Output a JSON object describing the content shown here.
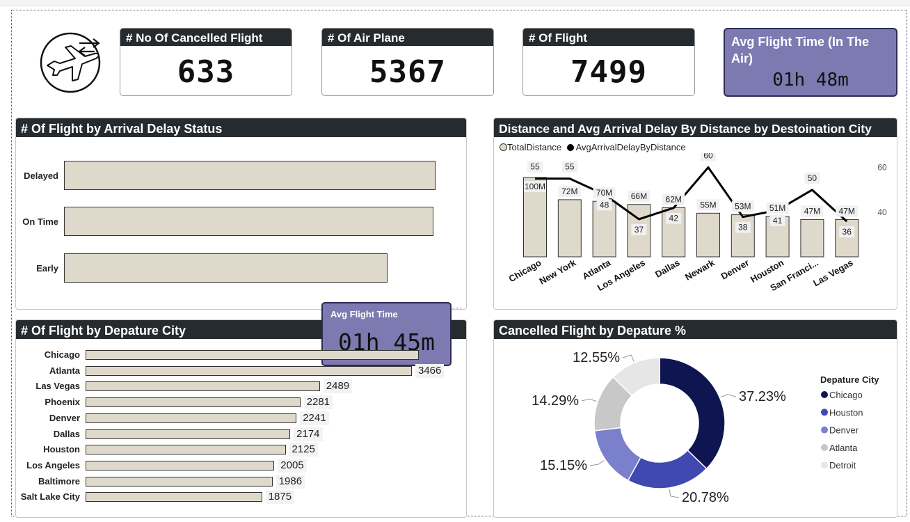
{
  "kpis": {
    "cancelled": {
      "label": "# No Of Cancelled Flight",
      "value": "633"
    },
    "airplanes": {
      "label": "# Of Air Plane",
      "value": "5367"
    },
    "flights": {
      "label": "# Of Flight",
      "value": "7499"
    },
    "avg_time": {
      "label": "Avg Flight Time (In The Air)",
      "value": "01h 48m"
    }
  },
  "tooltip": {
    "label": "Avg Flight Time",
    "value": "01h 45m"
  },
  "logo_icon": "airplane-circle-icon",
  "chart_data": [
    {
      "type": "bar",
      "title": "# Of Flight by Arrival Delay Status",
      "orientation": "horizontal",
      "categories": [
        "Delayed",
        "On Time",
        "Early"
      ],
      "values": [
        2525,
        2510,
        2200
      ],
      "color": "#dfd9cc"
    },
    {
      "type": "bar",
      "title": "Distance and Avg Arrival Delay By Distance by Destoination City",
      "legend": [
        "TotalDistance",
        "AvgArrivalDelayByDistance"
      ],
      "legend_position": "top-left",
      "categories": [
        "Chicago",
        "New York",
        "Atlanta",
        "Los Angeles",
        "Dallas",
        "Newark",
        "Denver",
        "Houston",
        "San Franci...",
        "Las Vegas"
      ],
      "series": [
        {
          "name": "TotalDistance",
          "type": "bar",
          "values": [
            100,
            72,
            70,
            66,
            62,
            55,
            53,
            51,
            47,
            47
          ],
          "labels": [
            "100M",
            "72M",
            "70M",
            "66M",
            "62M",
            "55M",
            "53M",
            "51M",
            "47M",
            "47M"
          ]
        },
        {
          "name": "AvgArrivalDelayByDistance",
          "type": "line",
          "values": [
            55,
            55,
            48,
            37,
            42,
            60,
            38,
            41,
            50,
            36
          ]
        }
      ],
      "y2_ticks": [
        40,
        60
      ],
      "y2lim": [
        24,
        62
      ],
      "ylim": [
        0,
        100
      ]
    },
    {
      "type": "bar",
      "title": "# Of Flight by Depature City",
      "orientation": "horizontal",
      "categories": [
        "Chicago",
        "Atlanta",
        "Las Vegas",
        "Phoenix",
        "Denver",
        "Dallas",
        "Houston",
        "Los Angeles",
        "Baltimore",
        "Salt Lake City"
      ],
      "values": [
        3540,
        3466,
        2489,
        2281,
        2241,
        2174,
        2125,
        2005,
        1986,
        1875
      ],
      "labels": [
        "",
        "3466",
        "2489",
        "2281",
        "2241",
        "2174",
        "2125",
        "2005",
        "1986",
        "1875"
      ],
      "xlim": [
        0,
        3540
      ]
    },
    {
      "type": "pie",
      "title": "Cancelled Flight by Depature %",
      "legend_title": "Depature City",
      "legend_position": "right",
      "slices": [
        {
          "name": "Chicago",
          "value": 37.23,
          "label": "37.23%",
          "color": "#0f1550"
        },
        {
          "name": "Houston",
          "value": 20.78,
          "label": "20.78%",
          "color": "#4049b0"
        },
        {
          "name": "Denver",
          "value": 15.15,
          "label": "15.15%",
          "color": "#7a80cc"
        },
        {
          "name": "Atlanta",
          "value": 14.29,
          "label": "14.29%",
          "color": "#c8c8c8"
        },
        {
          "name": "Detroit",
          "value": 12.55,
          "label": "12.55%",
          "color": "#e6e6e6"
        }
      ]
    }
  ]
}
